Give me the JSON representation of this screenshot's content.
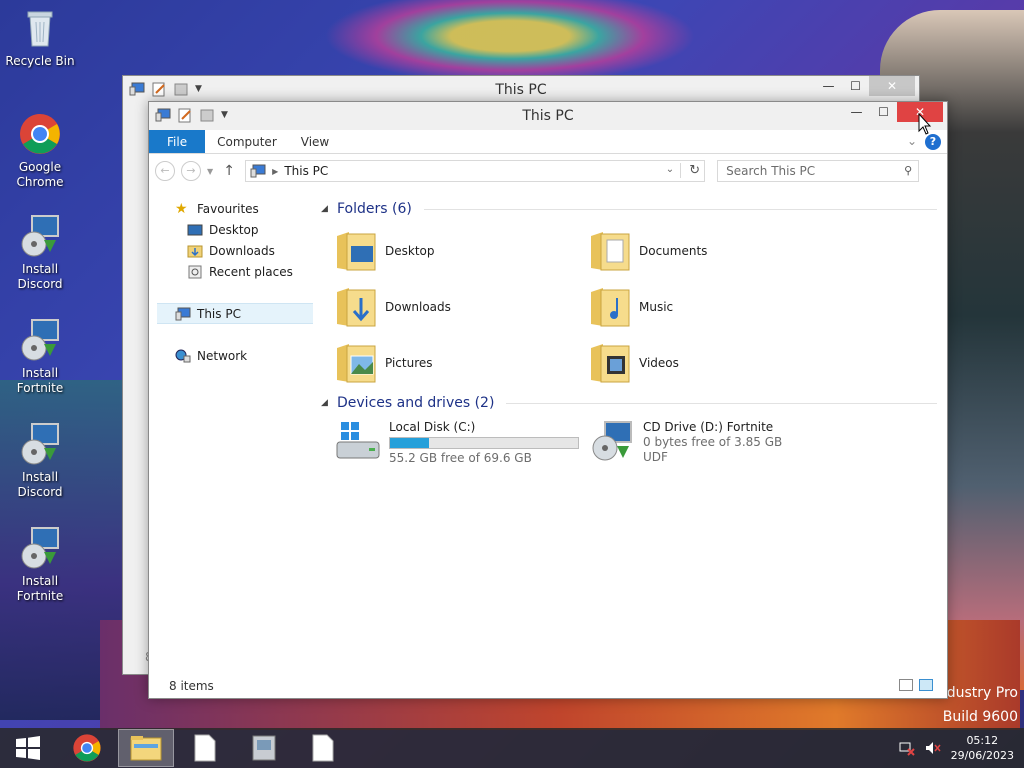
{
  "desktop": {
    "icons": [
      {
        "label": "Recycle Bin"
      },
      {
        "label": "Google Chrome"
      },
      {
        "label": "Install Discord"
      },
      {
        "label": "Install Fortnite"
      },
      {
        "label": "Install Discord"
      },
      {
        "label": "Install Fortnite"
      }
    ],
    "watermark_line1": "ndustry Pro",
    "watermark_line2": "Build 9600"
  },
  "back_window": {
    "title": "This PC",
    "partial_digit": "8"
  },
  "window": {
    "title": "This PC",
    "ribbon": {
      "tabs": [
        "File",
        "Computer",
        "View"
      ],
      "help": "?"
    },
    "address": {
      "location": "This PC",
      "search_placeholder": "Search This PC"
    },
    "nav": {
      "favourites": "Favourites",
      "items": [
        "Desktop",
        "Downloads",
        "Recent places"
      ],
      "this_pc": "This PC",
      "network": "Network"
    },
    "folders": {
      "header": "Folders (6)",
      "items": [
        "Desktop",
        "Documents",
        "Downloads",
        "Music",
        "Pictures",
        "Videos"
      ]
    },
    "devices": {
      "header": "Devices and drives (2)",
      "drives": [
        {
          "name": "Local Disk (C:)",
          "free": "55.2 GB free of 69.6 GB",
          "used_fraction": 0.21
        },
        {
          "name": "CD Drive (D:) Fortnite",
          "free": "0 bytes free of 3.85 GB",
          "fs": "UDF"
        }
      ]
    },
    "status": "8 items"
  },
  "taskbar": {
    "time": "05:12",
    "date": "29/06/2023"
  },
  "colors": {
    "accent": "#1979ca",
    "close_red": "#e04343",
    "progress": "#26a0da"
  }
}
